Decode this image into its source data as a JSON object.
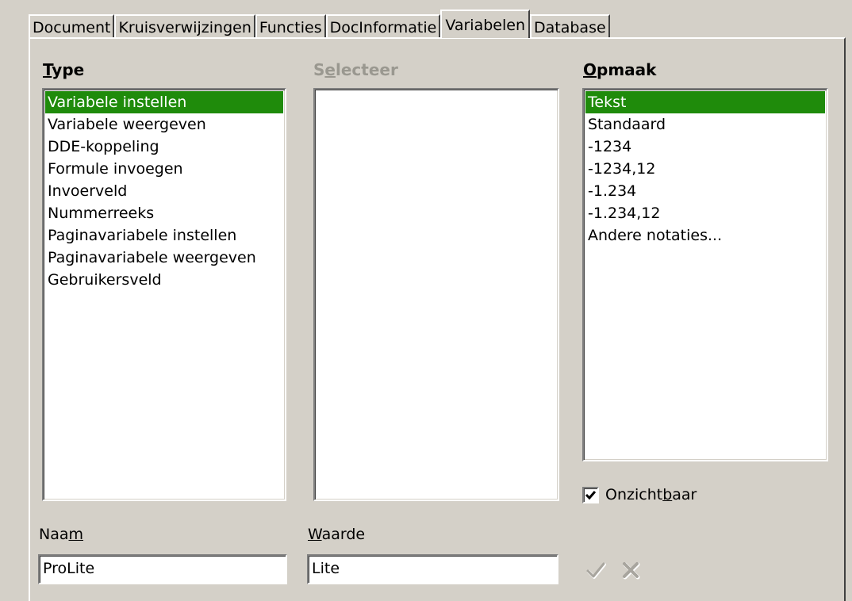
{
  "tabs": [
    {
      "label": "Document"
    },
    {
      "label": "Kruisverwijzingen"
    },
    {
      "label": "Functies"
    },
    {
      "label": "DocInformatie"
    },
    {
      "label": "Variabelen"
    },
    {
      "label": "Database"
    }
  ],
  "active_tab": "Variabelen",
  "type_section": {
    "label_first": "T",
    "label_rest": "ype",
    "items": [
      "Variabele instellen",
      "Variabele weergeven",
      "DDE-koppeling",
      "Formule invoegen",
      "Invoerveld",
      "Nummerreeks",
      "Paginavariabele instellen",
      "Paginavariabele weergeven",
      "Gebruikersveld"
    ],
    "selected": "Variabele instellen"
  },
  "select_section": {
    "label_first": "S",
    "label_underlined": "e",
    "label_rest": "lecteer"
  },
  "format_section": {
    "label_first": "O",
    "label_rest": "pmaak",
    "items": [
      "Tekst",
      "Standaard",
      "-1234",
      "-1234,12",
      "-1.234",
      "-1.234,12",
      "Andere notaties..."
    ],
    "selected": "Tekst"
  },
  "invisible_checkbox": {
    "label_before": "Onzicht",
    "label_underlined": "b",
    "label_after": "aar",
    "checked": true
  },
  "name_field": {
    "label_before": "Naa",
    "label_underlined": "m",
    "value": "ProLite"
  },
  "value_field": {
    "label_underlined": "W",
    "label_after": "aarde",
    "value": "Lite"
  },
  "colors": {
    "selection": "#1f8b0b",
    "dialog_bg": "#d4d0c8"
  },
  "icons": {
    "apply": "checkmark-icon",
    "delete": "x-delete-icon"
  }
}
